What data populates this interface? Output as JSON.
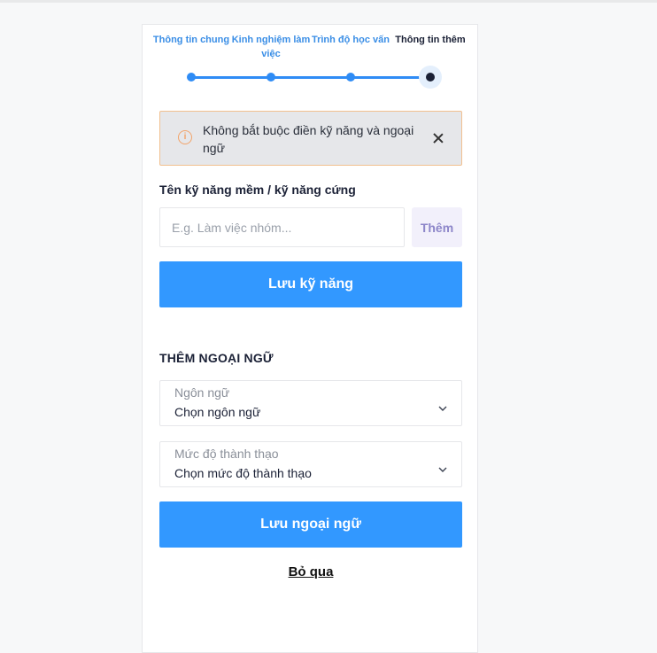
{
  "steps": [
    {
      "label": "Thông tin chung"
    },
    {
      "label": "Kinh nghiệm làm việc"
    },
    {
      "label": "Trình độ học vấn"
    },
    {
      "label": "Thông tin thêm"
    }
  ],
  "notice": {
    "text": "Không bắt buộc điền kỹ năng và ngoại ngữ",
    "icon": "info-icon",
    "accent": "#f2a46a"
  },
  "skills": {
    "label": "Tên kỹ năng mềm / kỹ năng cứng",
    "input_value": "",
    "placeholder": "E.g. Làm việc nhóm...",
    "add_label": "Thêm",
    "save_label": "Lưu kỹ năng"
  },
  "languages": {
    "title": "THÊM NGOẠI NGỮ",
    "language_caption": "Ngôn ngữ",
    "language_value": "Chọn ngôn ngữ",
    "level_caption": "Mức độ thành thạo",
    "level_value": "Chọn mức độ thành thạo",
    "save_label": "Lưu ngoại ngữ"
  },
  "skip_label": "Bỏ qua",
  "colors": {
    "primary": "#3298ff",
    "step_active": "#1b2136",
    "step_done": "#2f8cf5"
  }
}
